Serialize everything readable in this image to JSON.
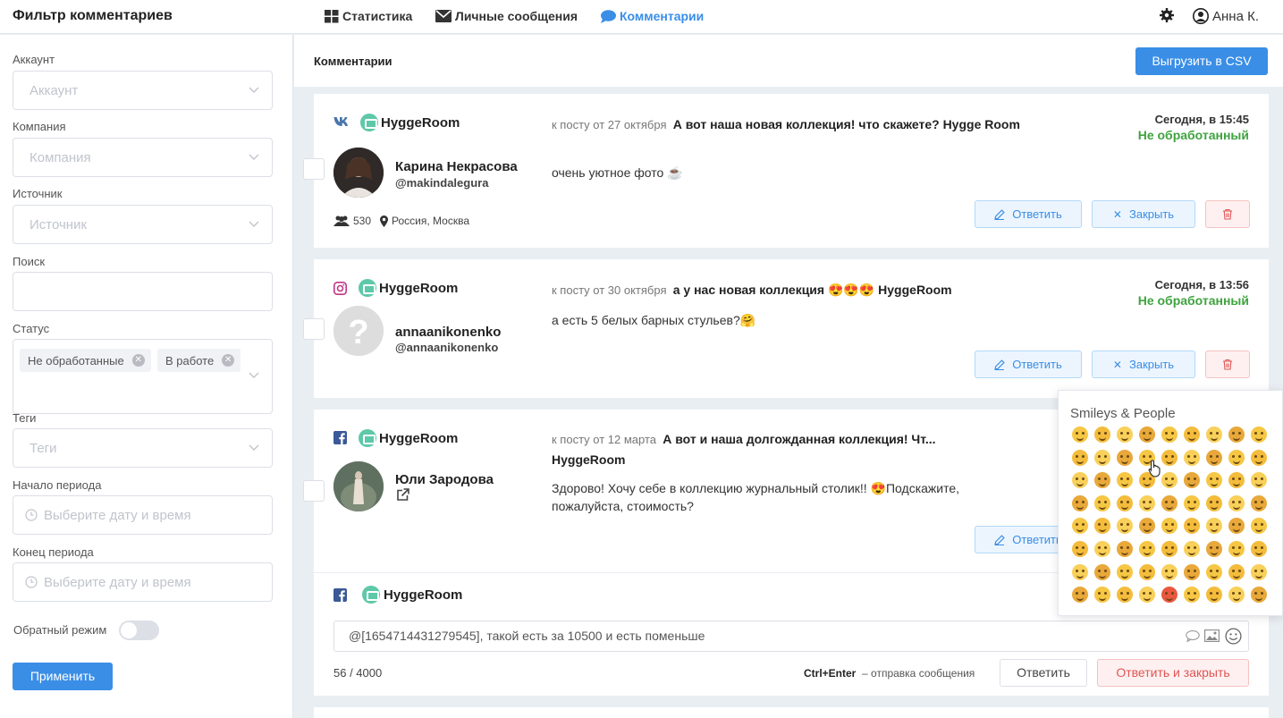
{
  "header": {
    "title": "Фильтр комментариев",
    "nav": [
      {
        "label": "Статистика",
        "icon": "grid-icon"
      },
      {
        "label": "Личные сообщения",
        "icon": "envelope-icon"
      },
      {
        "label": "Комментарии",
        "icon": "chat-bubble-icon",
        "active": true
      }
    ],
    "user": "Анна К."
  },
  "sidebar": {
    "account": {
      "label": "Аккаунт",
      "placeholder": "Аккаунт"
    },
    "company": {
      "label": "Компания",
      "placeholder": "Компания"
    },
    "source": {
      "label": "Источник",
      "placeholder": "Источник"
    },
    "search": {
      "label": "Поиск",
      "value": ""
    },
    "status": {
      "label": "Статус",
      "tags": [
        "Не обработанные",
        "В работе"
      ]
    },
    "tags": {
      "label": "Теги",
      "placeholder": "Теги"
    },
    "period_start": {
      "label": "Начало периода",
      "placeholder": "Выберите дату и время"
    },
    "period_end": {
      "label": "Конец периода",
      "placeholder": "Выберите дату и время"
    },
    "reverse_mode": {
      "label": "Обратный режим",
      "on": false
    },
    "apply_label": "Применить"
  },
  "main": {
    "title": "Комментарии",
    "export_label": "Выгрузить в CSV",
    "reply_label": "Ответить",
    "close_label": "Закрыть",
    "comments": [
      {
        "source": "vk",
        "brand": "HyggeRoom",
        "author_name": "Карина Некрасова",
        "author_handle": "@makindalegura",
        "followers": "530",
        "location": "Россия, Москва",
        "post_prefix": "к посту от 27 октября",
        "post_title": "А вот наша новая коллекция! что скажете? Hygge Room",
        "text": "очень уютное фото ☕",
        "date": "Сегодня, в 15:45",
        "status": "Не обработанный"
      },
      {
        "source": "instagram",
        "brand": "HyggeRoom",
        "author_name": "annaanikonenko",
        "author_handle": "@annaanikonenko",
        "post_prefix": "к посту от 30 октября",
        "post_title": "а у нас новая коллекция 😍😍😍 HyggeRoom",
        "text": "а есть 5 белых барных стульев?🤗",
        "date": "Сегодня, в 13:56",
        "status": "Не обработанный"
      },
      {
        "source": "facebook",
        "brand": "HyggeRoom",
        "author_name": "Юли Зародова",
        "post_prefix": "к посту от 12 марта",
        "post_title": "А вот и наша долгожданная коллекция! Чт... HyggeRoom",
        "text": "Здорово! Хочу себе в коллекцию журнальный столик!! 😍Подскажите, пожалуйста, стоимость?"
      }
    ],
    "reply_box": {
      "source": "facebook",
      "brand": "HyggeRoom",
      "value": "@[1654714431279545], такой есть за 10500 и есть поменьше",
      "counter": "56 / 4000",
      "hint_key": "Ctrl+Enter",
      "hint_text": "– отправка сообщения",
      "send_label": "Ответить",
      "send_close_label": "Ответить и закрыть"
    }
  },
  "emoji_picker": {
    "category": "Smileys & People",
    "count": 72
  }
}
